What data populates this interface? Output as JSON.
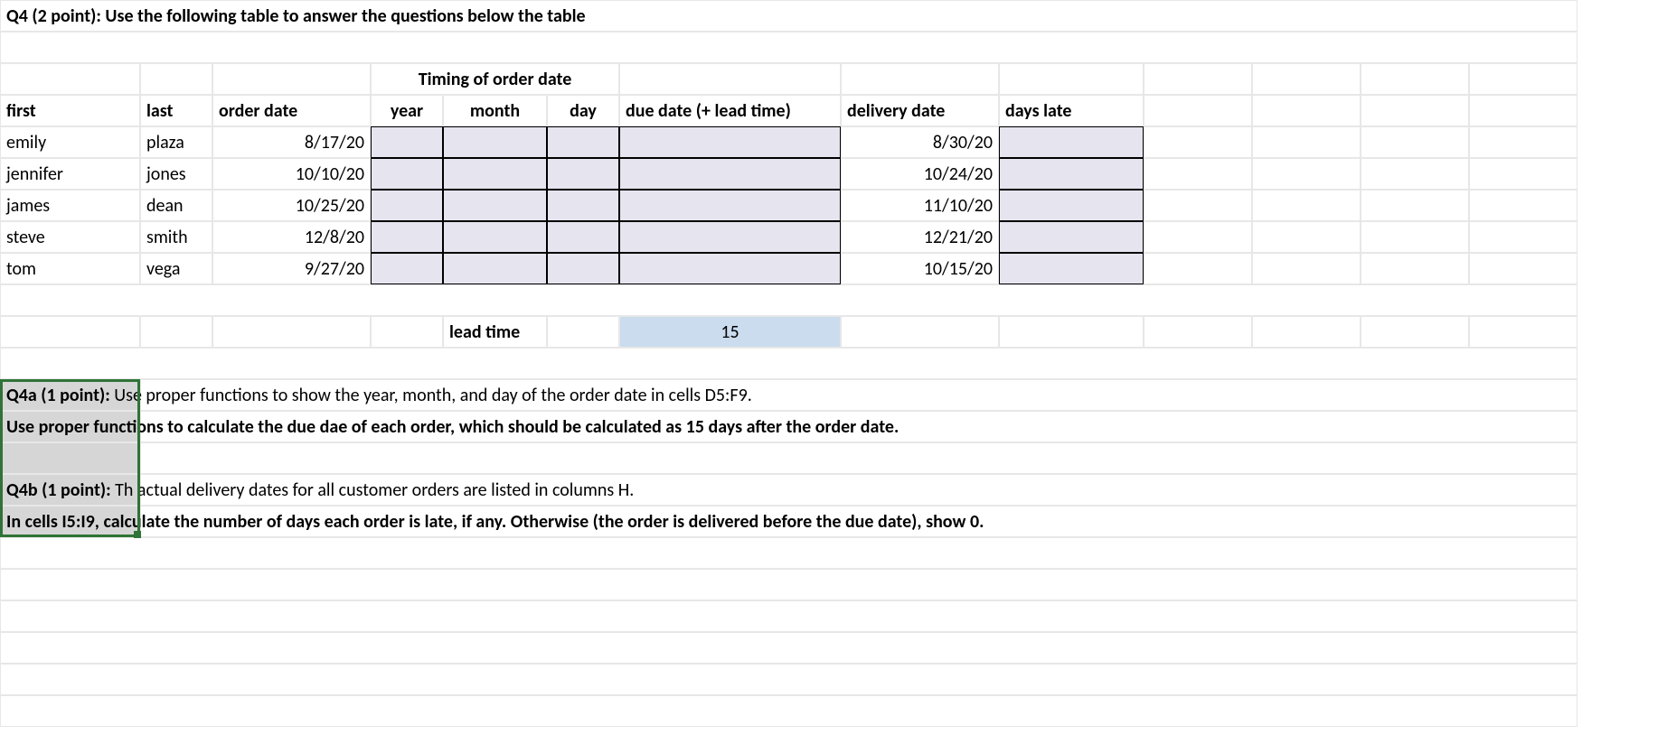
{
  "title": "Q4 (2 point): Use the following table to answer the questions below the table",
  "timing_header": "Timing of order date",
  "headers": {
    "first": "first",
    "last": "last",
    "order_date": "order date",
    "year": "year",
    "month": "month",
    "day": "day",
    "due_date": "due date (+ lead time)",
    "delivery_date": "delivery date",
    "days_late": "days late"
  },
  "rows": [
    {
      "first": "emily",
      "last": "plaza",
      "order_date": "8/17/20",
      "delivery_date": "8/30/20"
    },
    {
      "first": "jennifer",
      "last": "jones",
      "order_date": "10/10/20",
      "delivery_date": "10/24/20"
    },
    {
      "first": "james",
      "last": "dean",
      "order_date": "10/25/20",
      "delivery_date": "11/10/20"
    },
    {
      "first": "steve",
      "last": "smith",
      "order_date": "12/8/20",
      "delivery_date": "12/21/20"
    },
    {
      "first": "tom",
      "last": "vega",
      "order_date": "9/27/20",
      "delivery_date": "10/15/20"
    }
  ],
  "lead_time_label": "lead time",
  "lead_time_value": "15",
  "q4a_label": "Q4a (1 point):",
  "q4a_text": "Use proper functions to show the year, month, and day of the order date in cells D5:F9.",
  "q4a_line2": "Use proper functions to calculate the due dae of each order, which should be calculated as 15 days after the order date.",
  "q4b_label": "Q4b (1 point):",
  "q4b_text": "Th actual delivery dates for all customer orders are listed in columns H.",
  "q4b_line2": "In cells I5:I9, calculate the number of days each order is late, if any. Otherwise (the order is delivered before the due date), show 0."
}
